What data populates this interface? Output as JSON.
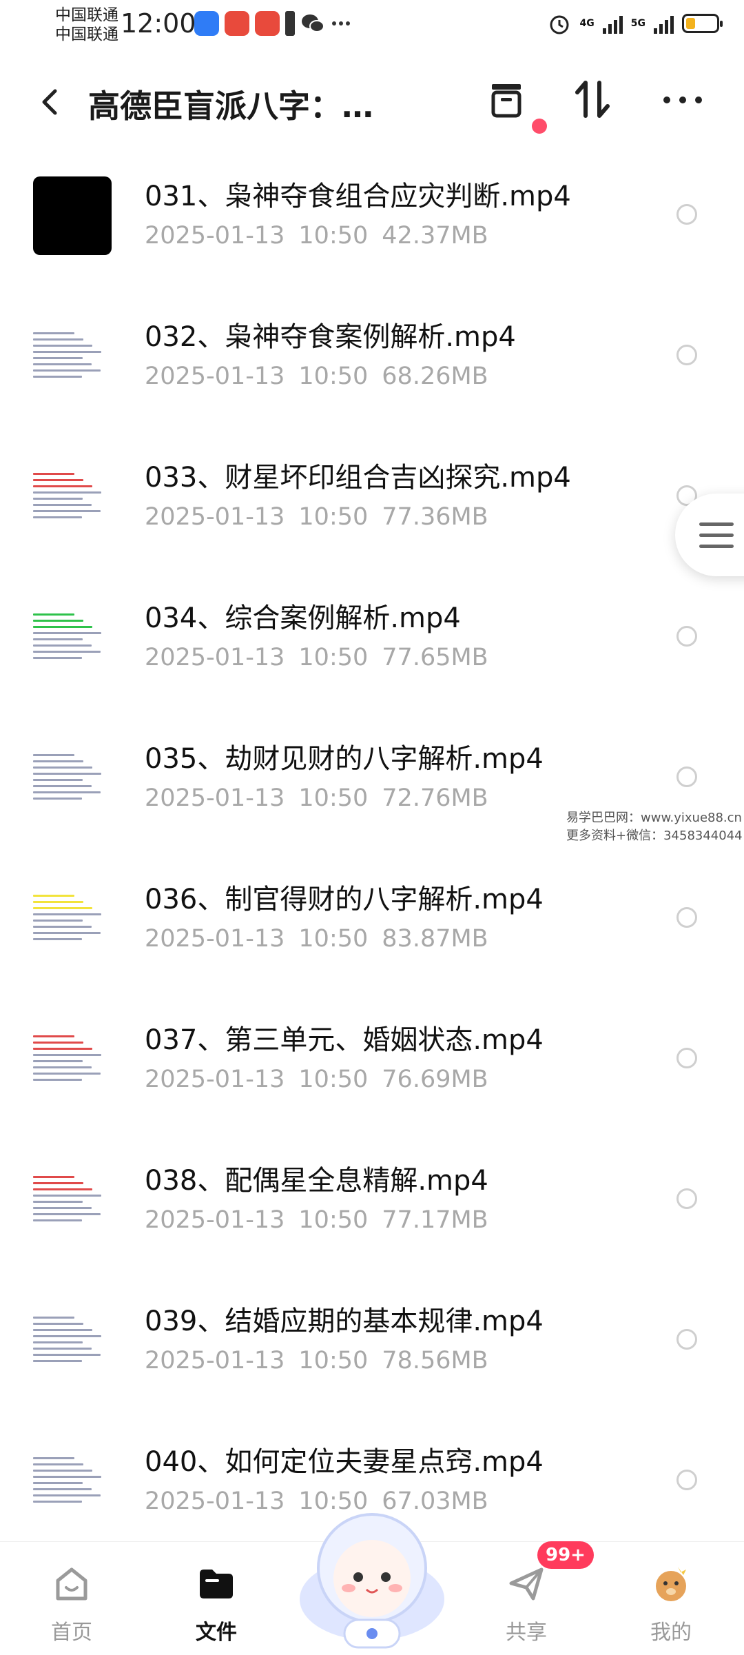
{
  "status_bar": {
    "carrier_1": "中国联通",
    "carrier_2": "中国联通",
    "time": "12:00",
    "network_1": "4G",
    "network_2": "5G",
    "battery_level": 0.3
  },
  "header": {
    "title": "高德臣盲派八字：…",
    "back_icon": "chevron-left-icon",
    "actions": [
      "archive-icon",
      "sort-icon",
      "more-icon"
    ]
  },
  "files": [
    {
      "name": "031、枭神夺食组合应灾判断.mp4",
      "date": "2025-01-13",
      "time": "10:50",
      "size": "42.37MB",
      "thumb": "black"
    },
    {
      "name": "032、枭神夺食案例解析.mp4",
      "date": "2025-01-13",
      "time": "10:50",
      "size": "68.26MB",
      "thumb": "doc"
    },
    {
      "name": "033、财星坏印组合吉凶探究.mp4",
      "date": "2025-01-13",
      "time": "10:50",
      "size": "77.36MB",
      "thumb": "doc-red"
    },
    {
      "name": "034、综合案例解析.mp4",
      "date": "2025-01-13",
      "time": "10:50",
      "size": "77.65MB",
      "thumb": "doc-green"
    },
    {
      "name": "035、劫财见财的八字解析.mp4",
      "date": "2025-01-13",
      "time": "10:50",
      "size": "72.76MB",
      "thumb": "doc"
    },
    {
      "name": "036、制官得财的八字解析.mp4",
      "date": "2025-01-13",
      "time": "10:50",
      "size": "83.87MB",
      "thumb": "doc-yellow"
    },
    {
      "name": "037、第三单元、婚姻状态.mp4",
      "date": "2025-01-13",
      "time": "10:50",
      "size": "76.69MB",
      "thumb": "doc-red"
    },
    {
      "name": "038、配偶星全息精解.mp4",
      "date": "2025-01-13",
      "time": "10:50",
      "size": "77.17MB",
      "thumb": "doc-red"
    },
    {
      "name": "039、结婚应期的基本规律.mp4",
      "date": "2025-01-13",
      "time": "10:50",
      "size": "78.56MB",
      "thumb": "doc"
    },
    {
      "name": "040、如何定位夫妻星点窍.mp4",
      "date": "2025-01-13",
      "time": "10:50",
      "size": "67.03MB",
      "thumb": "doc"
    }
  ],
  "watermark": {
    "line1": "易学巴巴网：www.yixue88.cn",
    "line2": "更多资料+微信：3458344044"
  },
  "bottom_nav": {
    "items": [
      {
        "label": "首页",
        "icon": "home-icon"
      },
      {
        "label": "文件",
        "icon": "folder-icon"
      },
      {
        "label": "共享",
        "icon": "share-icon"
      },
      {
        "label": "我的",
        "icon": "profile-icon"
      }
    ],
    "share_badge": "99+"
  }
}
